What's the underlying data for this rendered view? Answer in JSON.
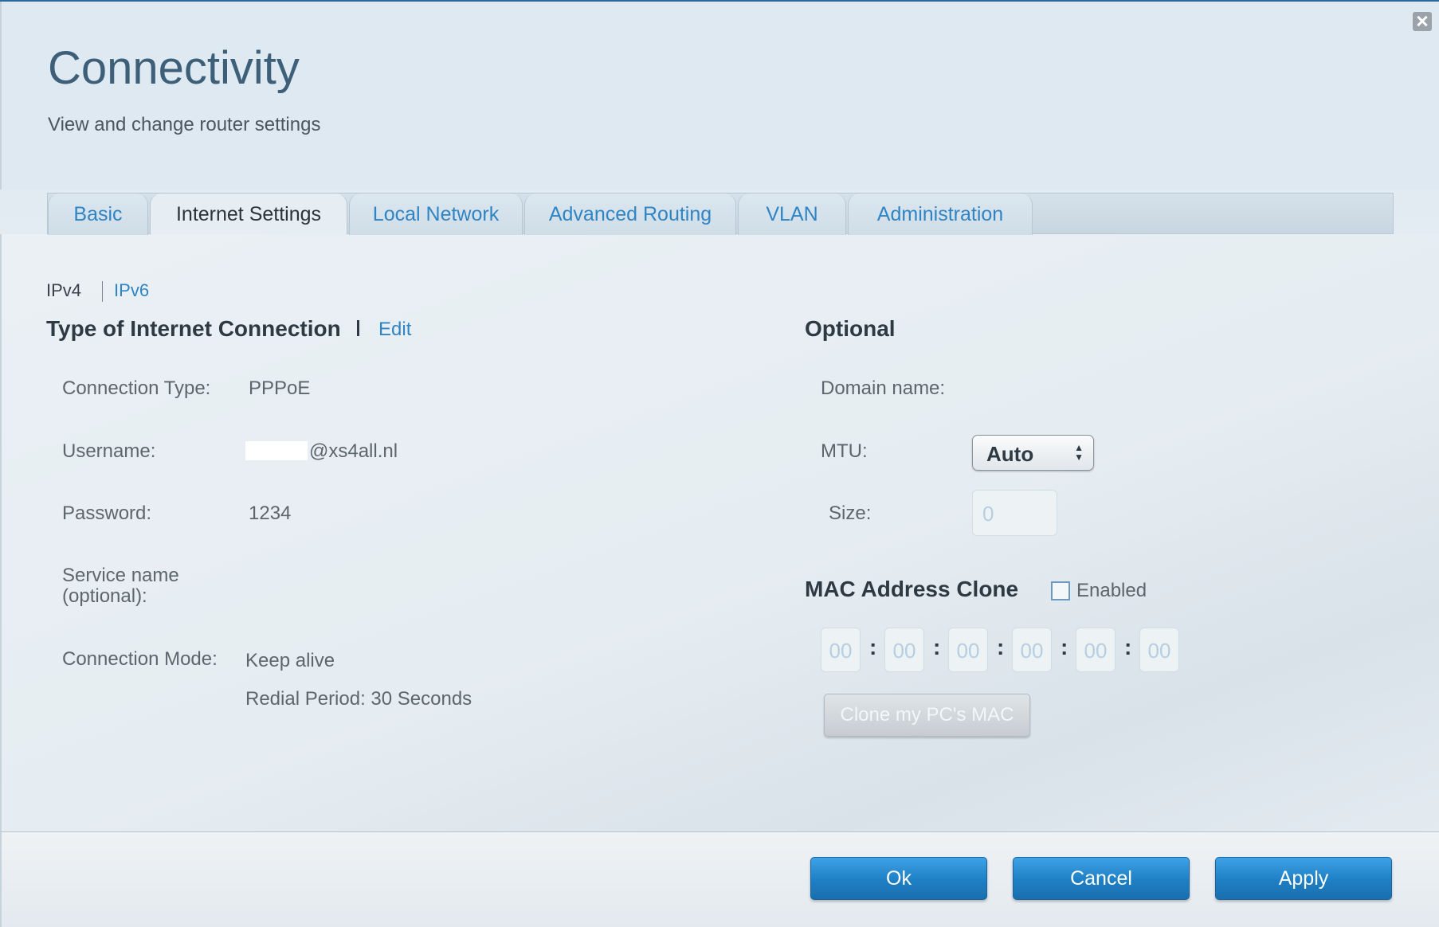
{
  "dialog": {
    "title": "Connectivity",
    "subtitle": "View and change router settings"
  },
  "tabs": [
    {
      "label": "Basic",
      "active": false
    },
    {
      "label": "Internet Settings",
      "active": true
    },
    {
      "label": "Local Network",
      "active": false
    },
    {
      "label": "Advanced Routing",
      "active": false
    },
    {
      "label": "VLAN",
      "active": false
    },
    {
      "label": "Administration",
      "active": false
    }
  ],
  "protocol_tabs": {
    "ipv4": "IPv4",
    "ipv6": "IPv6"
  },
  "connection": {
    "heading": "Type of Internet Connection",
    "edit_label": "Edit",
    "type_label": "Connection Type:",
    "type_value": "PPPoE",
    "username_label": "Username:",
    "username_value": "@xs4all.nl",
    "password_label": "Password:",
    "password_value": "1234",
    "service_label_line1": "Service name",
    "service_label_line2": "(optional):",
    "mode_label": "Connection Mode:",
    "mode_value": "Keep alive",
    "redial_value": "Redial Period: 30 Seconds"
  },
  "optional": {
    "heading": "Optional",
    "domain_label": "Domain name:",
    "mtu_label": "MTU:",
    "mtu_value": "Auto",
    "size_label": "Size:",
    "size_placeholder": "0"
  },
  "mac_clone": {
    "heading": "MAC Address Clone",
    "enabled_label": "Enabled",
    "enabled": false,
    "octets": [
      "00",
      "00",
      "00",
      "00",
      "00",
      "00"
    ],
    "separator": ":",
    "clone_button": "Clone my PC's MAC"
  },
  "footer": {
    "ok": "Ok",
    "cancel": "Cancel",
    "apply": "Apply"
  },
  "colors": {
    "accent": "#2f84c4",
    "button_blue": "#1e7fc4",
    "title": "#3d5f78"
  },
  "icons": {
    "close": "close-icon"
  }
}
